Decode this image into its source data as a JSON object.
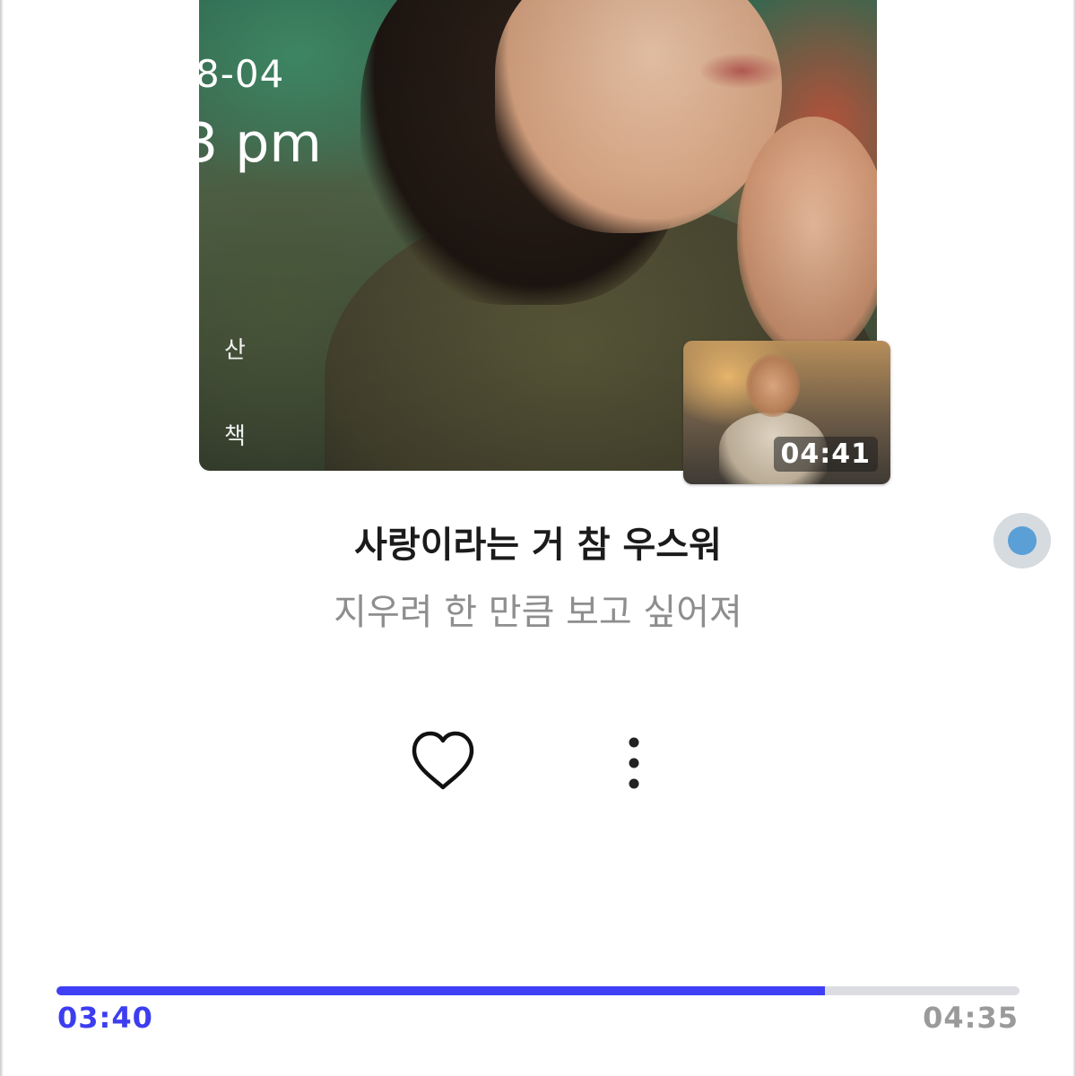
{
  "album_art": {
    "date": "8-04",
    "time": "3 pm",
    "vertical_text": [
      "산",
      "책"
    ]
  },
  "video": {
    "duration": "04:41"
  },
  "song": {
    "title": "사랑이라는 거 참 우스워",
    "lyric": "지우려 한 만큼 보고 싶어져"
  },
  "icons": {
    "like": "heart-icon",
    "more": "more-vertical-icon"
  },
  "colors": {
    "accent": "#3f3ff5",
    "floating_dot": "#5a9fd6"
  },
  "playback": {
    "current_time": "03:40",
    "total_time": "04:35",
    "progress": 0.798
  }
}
